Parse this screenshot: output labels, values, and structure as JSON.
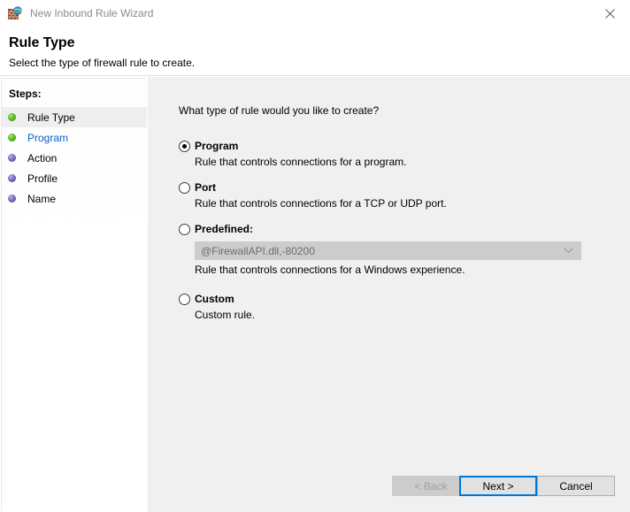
{
  "window": {
    "title": "New Inbound Rule Wizard",
    "app_icon": "firewall-globe-icon",
    "close_label": "×"
  },
  "header": {
    "title": "Rule Type",
    "subtitle": "Select the type of firewall rule to create."
  },
  "sidebar": {
    "heading": "Steps:",
    "items": [
      {
        "label": "Rule Type",
        "state": "current",
        "bullet": "green"
      },
      {
        "label": "Program",
        "state": "link",
        "bullet": "green"
      },
      {
        "label": "Action",
        "state": "pending",
        "bullet": "purple"
      },
      {
        "label": "Profile",
        "state": "pending",
        "bullet": "purple"
      },
      {
        "label": "Name",
        "state": "pending",
        "bullet": "purple"
      }
    ]
  },
  "main": {
    "question": "What type of rule would you like to create?",
    "options": [
      {
        "label": "Program",
        "description": "Rule that controls connections for a program.",
        "selected": true
      },
      {
        "label": "Port",
        "description": "Rule that controls connections for a TCP or UDP port.",
        "selected": false
      },
      {
        "label": "Predefined:",
        "description": "Rule that controls connections for a Windows experience.",
        "selected": false
      },
      {
        "label": "Custom",
        "description": "Custom rule.",
        "selected": false
      }
    ],
    "predefined_combo": {
      "value": "@FirewallAPI.dll,-80200",
      "enabled": false
    }
  },
  "footer": {
    "back_label": "< Back",
    "next_label": "Next >",
    "cancel_label": "Cancel"
  },
  "colors": {
    "accent": "#0078d7",
    "link": "#0a64c8",
    "content_bg": "#f0f0f0",
    "step_done": "#5fc22a",
    "step_pending": "#7a75c6",
    "disabled_text": "#a0a0a0"
  }
}
